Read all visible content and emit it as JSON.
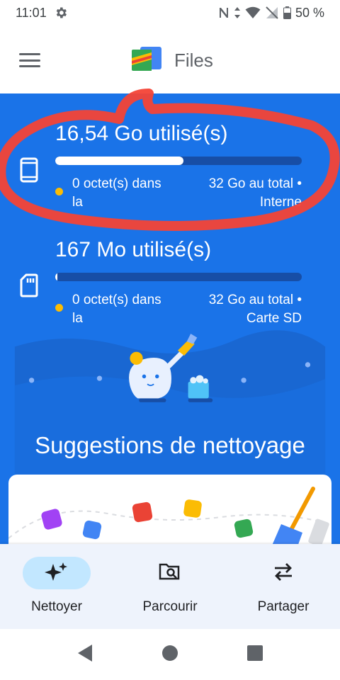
{
  "status_bar": {
    "time": "11:01",
    "battery": "50 %"
  },
  "app_bar": {
    "title": "Files"
  },
  "storage": {
    "internal": {
      "used_title": "16,54 Go utilisé(s)",
      "left_caption": "0 octet(s) dans la",
      "right_caption": "32 Go au total • Interne",
      "used_fraction": 0.52
    },
    "sd": {
      "used_title": "167 Mo utilisé(s)",
      "left_caption": "0 octet(s) dans la",
      "right_caption": "32 Go au total • Carte SD",
      "used_fraction": 0.01
    }
  },
  "suggestions": {
    "title": "Suggestions de nettoyage"
  },
  "bottom_nav": {
    "items": [
      {
        "label": "Nettoyer",
        "icon": "sparkle-icon",
        "active": true
      },
      {
        "label": "Parcourir",
        "icon": "browse-folder-icon",
        "active": false
      },
      {
        "label": "Partager",
        "icon": "swap-arrows-icon",
        "active": false
      }
    ]
  },
  "colors": {
    "primary": "#1a73e8",
    "primary_dark": "#174ea6",
    "accent_yellow": "#fbbc04",
    "annotation_red": "#f44336",
    "nav_background": "#eef3fc",
    "nav_active_pill": "#c2e7ff"
  },
  "system_nav": {
    "buttons": [
      "back-icon",
      "home-icon",
      "recents-icon"
    ]
  }
}
